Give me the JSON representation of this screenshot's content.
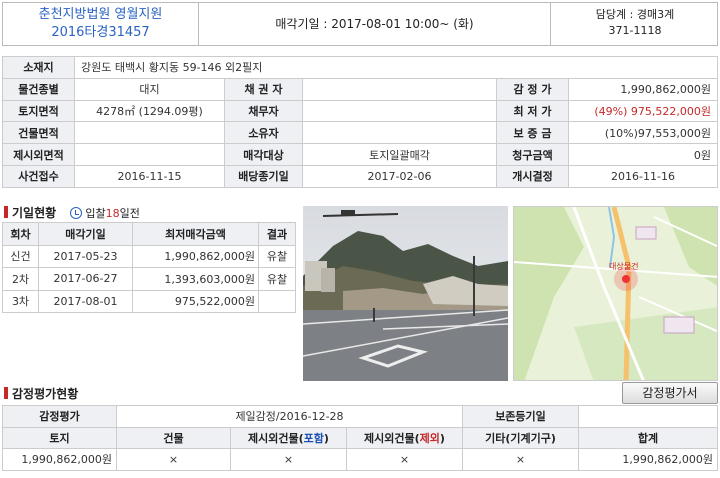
{
  "header": {
    "court": "춘천지방법원 영월지원",
    "case_no": "2016타경31457",
    "sale_date": "매각기일 : 2017-08-01   10:00~ (화)",
    "dept": "담당계 : 경매3계",
    "phone": "371-1118"
  },
  "info": {
    "address_label": "소재지",
    "address_value": "강원도 태백시 황지동 59-146 외2필지",
    "use_label": "물건종별",
    "use_value": "대지",
    "creditor_label": "채 권 자",
    "creditor_value": "",
    "appraisal_label": "감 정 가",
    "appraisal_value": "1,990,862,000원",
    "land_label": "토지면적",
    "land_value": "4278㎡ (1294.09평)",
    "debtor_label": "채무자",
    "debtor_value": "",
    "min_label": "최 저 가",
    "min_value": "(49%) 975,522,000원",
    "building_label": "건물면적",
    "building_value": "",
    "owner_label": "소유자",
    "owner_value": "",
    "deposit_label": "보 증 금",
    "deposit_value": "(10%)97,553,000원",
    "exclude_label": "제시외면적",
    "exclude_value": "",
    "target_label": "매각대상",
    "target_value": "토지일괄매각",
    "claim_label": "청구금액",
    "claim_value": "0원",
    "receipt_label": "사건접수",
    "receipt_value": "2016-11-15",
    "dividend_label": "배당종기일",
    "dividend_value": "2017-02-06",
    "start_label": "개시결정",
    "start_value": "2016-11-16"
  },
  "history": {
    "title": "기일현황",
    "badge_prefix": "입찰",
    "badge_days": "18",
    "badge_suffix": "일전",
    "headers": [
      "회차",
      "매각기일",
      "최저매각금액",
      "결과"
    ],
    "rows": [
      {
        "round": "신건",
        "date": "2017-05-23",
        "amount": "1,990,862,000원",
        "result": "유찰"
      },
      {
        "round": "2차",
        "date": "2017-06-27",
        "amount": "1,393,603,000원",
        "result": "유찰"
      },
      {
        "round": "3차",
        "date": "2017-08-01",
        "amount": "975,522,000원",
        "result": ""
      }
    ]
  },
  "map": {
    "label": "대상물건"
  },
  "appraisal": {
    "title": "감정평가현황",
    "button": "감정평가서",
    "row1": {
      "l1": "감정평가",
      "v1": "제일감정/2016-12-28",
      "l2": "보존등기일",
      "v2": ""
    },
    "headers": {
      "land": "토지",
      "building": "건물",
      "ex_in_pre": "제시외건물(",
      "ex_in_word": "포함",
      "ex_in_post": ")",
      "ex_out_pre": "제시외건물(",
      "ex_out_word": "제외",
      "ex_out_post": ")",
      "etc": "기타(기계기구)",
      "total": "합계"
    },
    "values": {
      "land": "1,990,862,000원",
      "building": "×",
      "ex_in": "×",
      "ex_out": "×",
      "etc": "×",
      "total": "1,990,862,000원"
    }
  },
  "colors": {
    "accent": "#2a63c4",
    "danger": "#c62828",
    "label_bg": "#eef0f4"
  }
}
